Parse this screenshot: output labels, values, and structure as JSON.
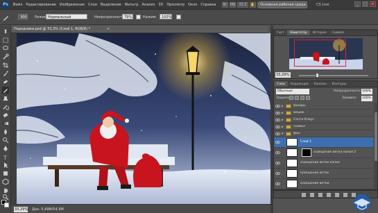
{
  "app": {
    "logo": "Ps",
    "menu": [
      "Файл",
      "Редактирование",
      "Изображение",
      "Слои",
      "Выделение",
      "Фильтр",
      "Анализ",
      "3D",
      "Просмотр",
      "Окно",
      "Справка"
    ],
    "zoom_readout": "33,3",
    "workspace_button": "Основная рабочая среда",
    "cs_live": "CS Live"
  },
  "options": {
    "brush_size": "300",
    "mode_label": "Режим:",
    "mode_value": "Нормальный",
    "opacity_label": "Непрозрачность:",
    "opacity_value": "79%",
    "pressure_label": "Нажим:",
    "pressure_value": "100%"
  },
  "document": {
    "title": "Породники.psd @ 33,3% (Слой 1, RGB/8) *",
    "close": "×",
    "zoom": "33,29%",
    "info": "Док: 5,49M/54,9M"
  },
  "navigator": {
    "tabs": [
      "Гист",
      "Навигатор",
      "История",
      "Символ"
    ],
    "active_tab": 1,
    "zoom": "33,29%"
  },
  "layers_panel": {
    "tabs": [
      "Слои",
      "Коррекция",
      "Каналы",
      "Контуры"
    ],
    "active_tab": 0,
    "blend_mode": "Обычные",
    "opacity_label": "Непрозрачность:",
    "opacity_value": "100%",
    "lock_label": "Закрепить:",
    "fill_label": "Заливка:",
    "fill_value": "100%",
    "layers": [
      {
        "name": "фонарь",
        "type": "group"
      },
      {
        "name": "мешок",
        "type": "group"
      },
      {
        "name": "Санта Клаус",
        "type": "group"
      },
      {
        "name": "скамья",
        "type": "group"
      },
      {
        "name": "фон",
        "type": "group"
      },
      {
        "name": "Слой 1",
        "type": "layer",
        "selected": true
      },
      {
        "name": "освещение ветки копия 2",
        "type": "layer",
        "mask": true
      },
      {
        "name": "освещение веток копия",
        "type": "layer"
      },
      {
        "name": "освещение веток",
        "type": "layer"
      },
      {
        "name": "освещение ветки",
        "type": "layer"
      },
      {
        "name": "освещение от фонаря",
        "type": "layer"
      }
    ]
  },
  "colors": {
    "selection": "#3d6fb0",
    "nav_frame": "#e0262b",
    "lamp_glow": "#f5c542",
    "santa_red": "#c8141e"
  }
}
